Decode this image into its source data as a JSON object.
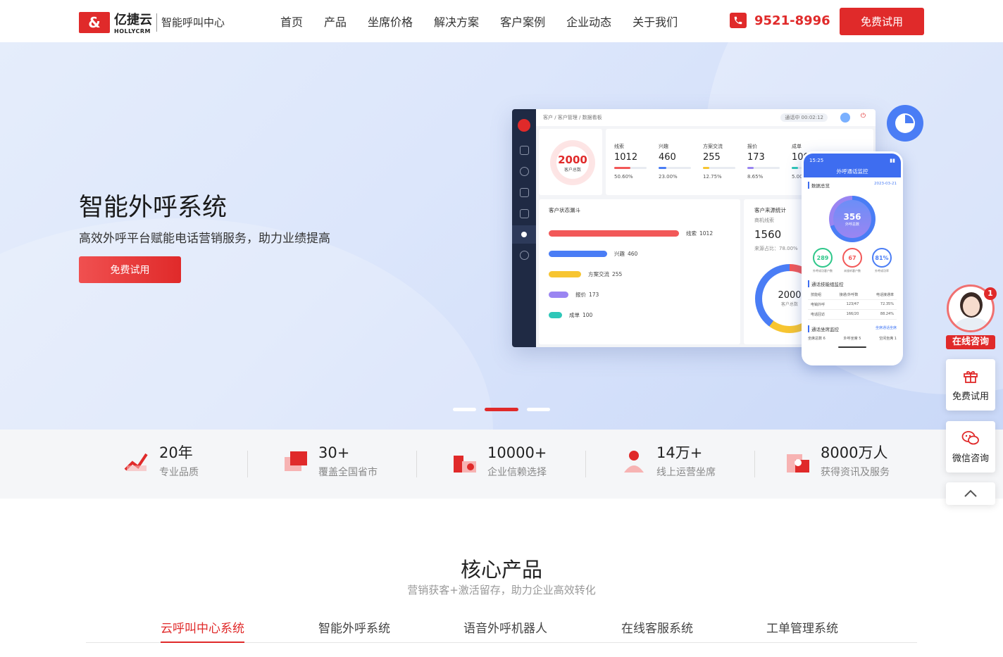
{
  "header": {
    "brand_cn": "亿捷云",
    "brand_en": "HOLLYCRM",
    "brand_tag": "智能呼叫中心",
    "nav": [
      "首页",
      "产品",
      "坐席价格",
      "解决方案",
      "客户案例",
      "企业动态",
      "关于我们"
    ],
    "phone": "9521-8996",
    "cta": "免费试用"
  },
  "hero": {
    "title": "智能外呼系统",
    "subtitle": "高效外呼平台赋能电话营销服务，助力业绩提高",
    "cta": "免费试用",
    "slides": {
      "count": 3,
      "active": 1
    }
  },
  "dashboard": {
    "breadcrumb": "客户 / 客户管理 / 数据看板",
    "call_status": "通话中  00:02:12",
    "total": {
      "value": "2000",
      "label": "客户总数"
    },
    "metrics": [
      {
        "label": "线索",
        "value": "1012",
        "pct": "50.60%",
        "color": "#f25858"
      },
      {
        "label": "兴趣",
        "value": "460",
        "pct": "23.00%",
        "color": "#4a7df5"
      },
      {
        "label": "方案交流",
        "value": "255",
        "pct": "12.75%",
        "color": "#f7c531"
      },
      {
        "label": "报价",
        "value": "173",
        "pct": "8.65%",
        "color": "#9a85f2"
      },
      {
        "label": "成单",
        "value": "100",
        "pct": "5.00%",
        "color": "#2ec7b8"
      }
    ],
    "funnel_title": "客户状态漏斗",
    "funnel": [
      {
        "label": "线索",
        "value": "1012",
        "fraction": 1.0,
        "color": "#f25858"
      },
      {
        "label": "兴趣",
        "value": "460",
        "fraction": 0.45,
        "color": "#4a7df5"
      },
      {
        "label": "方案交流",
        "value": "255",
        "fraction": 0.25,
        "color": "#f7c531"
      },
      {
        "label": "报价",
        "value": "173",
        "fraction": 0.15,
        "color": "#9a85f2"
      },
      {
        "label": "成单",
        "value": "100",
        "fraction": 0.1,
        "color": "#2ec7b8"
      }
    ],
    "source_title": "客户来源统计",
    "source_sub": "商机线索",
    "source_value": "1560",
    "source_ratio": "来源占比：78.00%",
    "donut_value": "2000",
    "donut_label": "客户总数"
  },
  "phone_ui": {
    "time": "15:25",
    "title": "外呼通话监控",
    "section1": "数据总览",
    "date": "2023-03-21",
    "center_value": "356",
    "center_label": "外呼总数",
    "small": [
      {
        "value": "289",
        "label": "外呼成功客户数",
        "color": "#2ec78a"
      },
      {
        "value": "67",
        "label": "未接听客户数",
        "color": "#f25858"
      },
      {
        "value": "81%",
        "label": "外呼成功率",
        "color": "#4a7df5"
      }
    ],
    "section2": "通话技能组监控",
    "table_head": [
      "技能组",
      "接通/外呼数",
      "电话接通率"
    ],
    "table_rows": [
      [
        "电销外呼",
        "123/47",
        "72.35%"
      ],
      [
        "电话回访",
        "166/20",
        "88.24%"
      ]
    ],
    "section3": "通话坐席监控",
    "section3_link": "坐席通话坐席",
    "seat_stats": [
      "坐席总数 6",
      "外呼坐席 5",
      "空闲坐席 1"
    ]
  },
  "stats": [
    {
      "value": "20年",
      "label": "专业品质",
      "icon": "chart-trend-icon"
    },
    {
      "value": "30+",
      "label": "覆盖全国省市",
      "icon": "map-layers-icon"
    },
    {
      "value": "10000+",
      "label": "企业信赖选择",
      "icon": "enterprise-icon"
    },
    {
      "value": "14万+",
      "label": "线上运营坐席",
      "icon": "agent-icon"
    },
    {
      "value": "8000万人",
      "label": "获得资讯及服务",
      "icon": "users-icon"
    }
  ],
  "core": {
    "title": "核心产品",
    "subtitle": "营销获客+激活留存，助力企业高效转化",
    "tabs": [
      "云呼叫中心系统",
      "智能外呼系统",
      "语音外呼机器人",
      "在线客服系统",
      "工单管理系统"
    ],
    "active_tab": 0
  },
  "float": {
    "consult": "在线咨询",
    "consult_badge": "1",
    "trial": "免费试用",
    "wechat": "微信咨询"
  },
  "colors": {
    "brand_red": "#e02a2a",
    "accent_blue": "#4a7df5"
  }
}
